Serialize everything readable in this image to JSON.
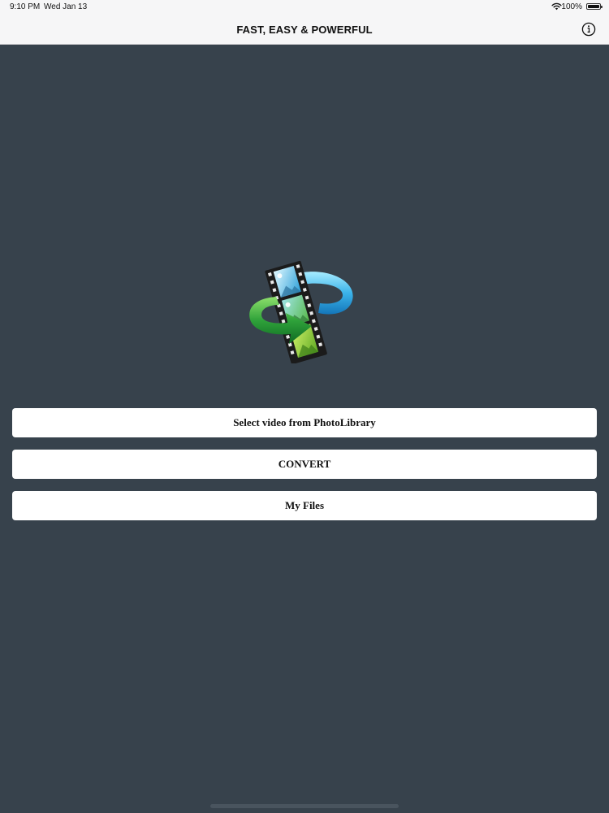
{
  "status_bar": {
    "time": "9:10 PM",
    "date": "Wed Jan 13",
    "battery": "100%",
    "battery_level": 1.0,
    "icons": [
      "wifi-icon",
      "battery-icon"
    ]
  },
  "nav": {
    "title": "FAST, EASY & POWERFUL",
    "info_icon": "info-icon"
  },
  "logo": {
    "icon": "video-convert-logo-icon"
  },
  "actions": {
    "select_label": "Select video from PhotoLibrary",
    "convert_label": "CONVERT",
    "files_label": "My Files"
  },
  "colors": {
    "background": "#37424c",
    "nav_bar": "#f6f6f7",
    "button": "#ffffff",
    "text": "#111111"
  }
}
